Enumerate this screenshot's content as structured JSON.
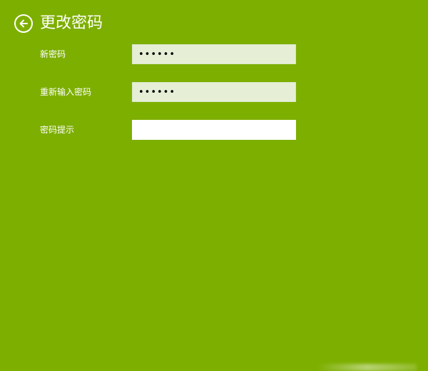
{
  "header": {
    "back_icon": "back-arrow-circle-icon",
    "title": "更改密码"
  },
  "form": {
    "fields": [
      {
        "label": "新密码",
        "value": "••••••",
        "type": "password"
      },
      {
        "label": "重新输入密码",
        "value": "••••••",
        "type": "password"
      },
      {
        "label": "密码提示",
        "value": "",
        "type": "text"
      }
    ]
  },
  "colors": {
    "background": "#7daf00",
    "filled_input_bg": "#e6efd6",
    "empty_input_bg": "#ffffff",
    "text": "#ffffff"
  }
}
